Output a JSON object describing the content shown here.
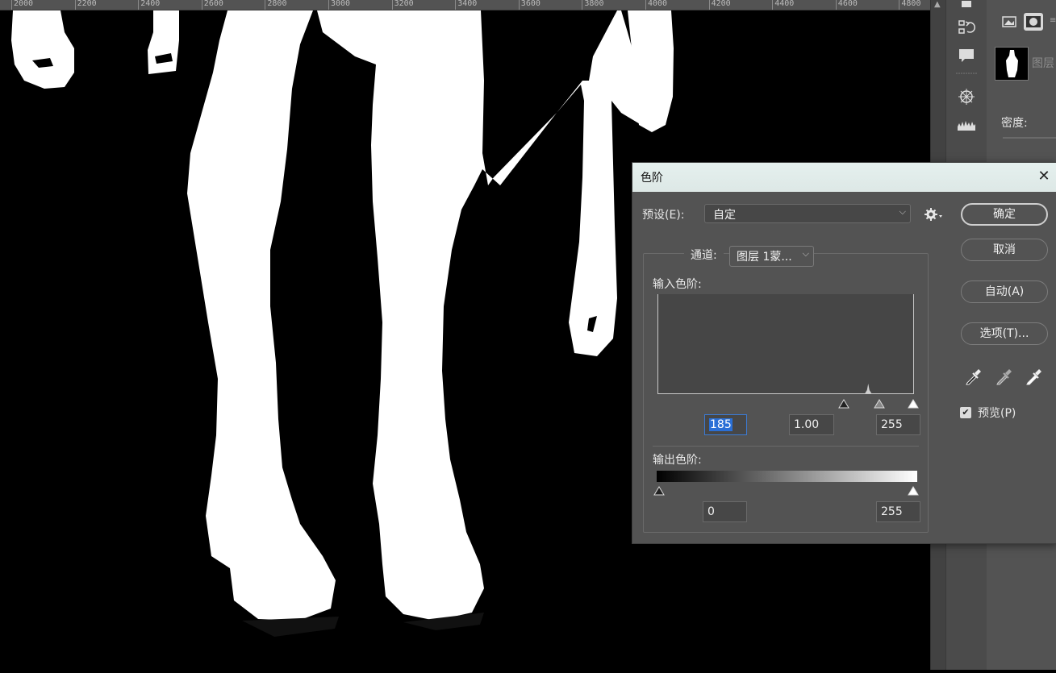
{
  "ruler": {
    "labels": [
      "2000",
      "2200",
      "2400",
      "2600",
      "2800",
      "3000",
      "3200",
      "3400",
      "3600",
      "3800",
      "4000",
      "4200",
      "4400",
      "4600",
      "4800"
    ]
  },
  "right_panel": {
    "layer_name": "图层",
    "density_label": "密度:"
  },
  "dialog": {
    "title": "色阶",
    "preset_label": "预设(E):",
    "preset_value": "自定",
    "channel_label": "通道:",
    "channel_value": "图层 1蒙...",
    "input_levels_label": "输入色阶:",
    "input_black": "185",
    "input_gamma": "1.00",
    "input_white": "255",
    "output_levels_label": "输出色阶:",
    "output_black": "0",
    "output_white": "255",
    "buttons": {
      "ok": "确定",
      "cancel": "取消",
      "auto": "自动(A)",
      "options": "选项(T)..."
    },
    "preview_label": "预览(P)",
    "preview_checked": true,
    "histogram": {
      "peak_level": 210
    }
  },
  "icons": {
    "close": "close-icon",
    "gear": "gear-icon",
    "eyedropper_black": "black-eyedropper-icon",
    "eyedropper_gray": "gray-eyedropper-icon",
    "eyedropper_white": "white-eyedropper-icon"
  },
  "colors": {
    "accent_selection": "#2a6fd6",
    "dialog_bg": "#535353",
    "title_bg": "#e5f0ee"
  }
}
